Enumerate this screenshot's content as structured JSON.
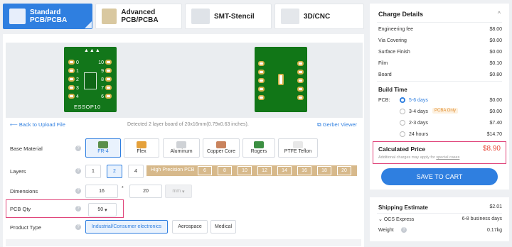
{
  "tabs": [
    {
      "label": "Standard PCB/PCBA"
    },
    {
      "label": "Advanced PCB/PCBA"
    },
    {
      "label": "SMT-Stencil"
    },
    {
      "label": "3D/CNC"
    }
  ],
  "preview": {
    "back_link": "Back to Upload File",
    "detected": "Detected 2 layer board of 20x16mm(0.79x0.63 inches).",
    "gerber_viewer": "Gerber Viewer",
    "silk_text": "ESSOP10",
    "pin_labels_left": [
      "0",
      "1",
      "2",
      "3",
      "4"
    ],
    "pin_labels_right": [
      "0",
      "10",
      "9",
      "8",
      "7",
      "6"
    ]
  },
  "form": {
    "base_material": {
      "label": "Base Material",
      "options": [
        "FR-4",
        "Flex",
        "Aluminum",
        "Copper Core",
        "Rogers",
        "PTFE Teflon"
      ],
      "selected": "FR-4"
    },
    "layers": {
      "label": "Layers",
      "options": [
        "1",
        "2",
        "4"
      ],
      "selected": "2",
      "hp_label": "High Precision PCB",
      "hp_options": [
        "6",
        "8",
        "10",
        "12",
        "14",
        "16",
        "18",
        "20"
      ]
    },
    "dimensions": {
      "label": "Dimensions",
      "width": "16",
      "x": "*",
      "height": "20",
      "unit": "mm"
    },
    "pcb_qty": {
      "label": "PCB Qty",
      "value": "50"
    },
    "product_type": {
      "label": "Product Type",
      "options": [
        "Industrial/Consumer electronics",
        "Aerospace",
        "Medical"
      ],
      "selected": "Industrial/Consumer electronics"
    }
  },
  "charges": {
    "title": "Charge Details",
    "items": [
      {
        "label": "Engineering fee",
        "value": "$8.00"
      },
      {
        "label": "Via Covering",
        "value": "$0.00"
      },
      {
        "label": "Surface Finish",
        "value": "$0.00"
      },
      {
        "label": "Film",
        "value": "$0.10"
      },
      {
        "label": "Board",
        "value": "$0.80"
      }
    ],
    "build_time_title": "Build Time",
    "pcb_label": "PCB:",
    "build_options": [
      {
        "label": "5-6 days",
        "value": "$0.00",
        "selected": true
      },
      {
        "label": "3-4 days",
        "badge": "PCBA Only",
        "value": "$0.00"
      },
      {
        "label": "2-3 days",
        "value": "$7.40"
      },
      {
        "label": "24 hours",
        "value": "$14.70"
      }
    ],
    "calc_label": "Calculated Price",
    "calc_value": "$8.90",
    "calc_note": "Additional charges may apply for",
    "calc_link": "special cases",
    "cta": "SAVE TO CART"
  },
  "shipping": {
    "title": "Shipping Estimate",
    "value": "$2.01",
    "method": "OCS Express",
    "days": "6-8 business days",
    "weight_label": "Weight",
    "weight_value": "0.17kg"
  },
  "colors": {
    "accent": "#2f7fe0",
    "price": "#e8473a",
    "highlight": "#e0447a"
  }
}
